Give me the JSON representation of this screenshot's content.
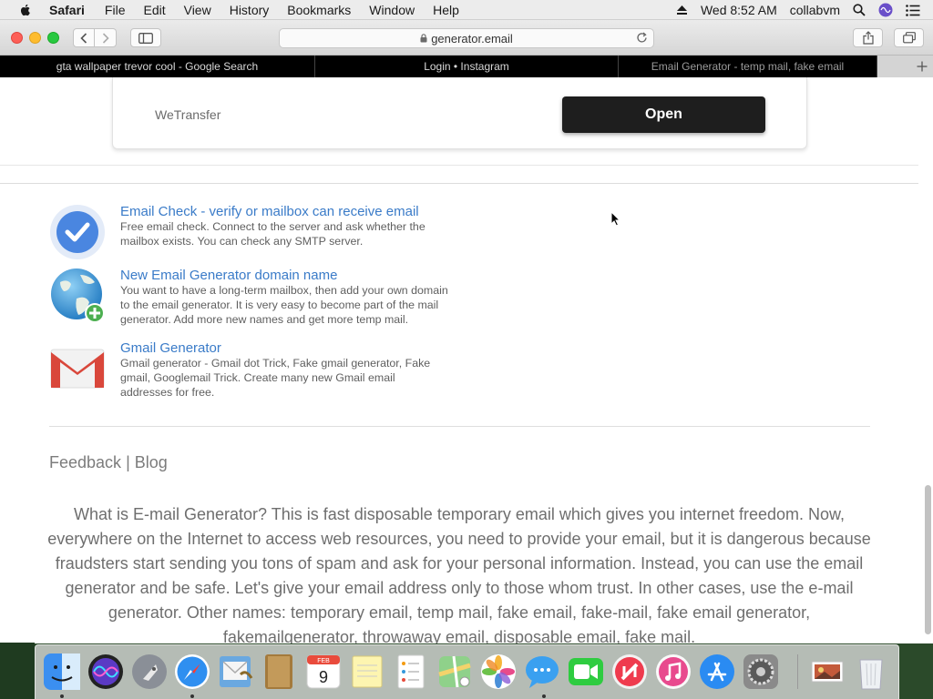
{
  "menubar": {
    "app_name": "Safari",
    "items": [
      "File",
      "Edit",
      "View",
      "History",
      "Bookmarks",
      "Window",
      "Help"
    ],
    "clock": "Wed 8:52 AM",
    "user": "collabvm"
  },
  "toolbar": {
    "url": "generator.email"
  },
  "tabs": [
    {
      "label": "gta wallpaper trevor cool - Google Search"
    },
    {
      "label": "Login • Instagram"
    },
    {
      "label": "Email Generator - temp mail, fake email"
    }
  ],
  "card": {
    "service": "WeTransfer",
    "button": "Open"
  },
  "features": [
    {
      "title": "Email Check - verify or mailbox can receive email",
      "description": "Free email check. Connect to the server and ask whether the mailbox exists. You can check any SMTP server.",
      "icon": "check-icon"
    },
    {
      "title": "New Email Generator domain name",
      "description": "You want to have a long-term mailbox, then add your own domain to the email generator. It is very easy to become part of the mail generator. Add more new names and get more temp mail.",
      "icon": "globe-add-icon"
    },
    {
      "title": "Gmail Generator",
      "description": "Gmail generator - Gmail dot Trick, Fake gmail generator, Fake gmail, Googlemail Trick. Create many new Gmail email addresses for free.",
      "icon": "gmail-icon"
    }
  ],
  "footer": {
    "feedback": "Feedback",
    "separator": " | ",
    "blog": "Blog"
  },
  "about": "What is E-mail Generator? This is fast disposable temporary email which gives you internet freedom. Now, everywhere on the Internet to access web resources, you need to provide your email, but it is dangerous because fraudsters start sending you tons of spam and ask for your personal information. Instead, you can use the email generator and be safe. Let's give your email address only to those whom trust. In other cases, use the e-mail generator. Other names: temporary email, temp mail, fake email, fake-mail, fake email generator, fakemailgenerator, throwaway email, disposable email, fake mail.",
  "dock": {
    "calendar_month": "FEB",
    "calendar_day": "9",
    "apps": [
      "Finder",
      "Siri",
      "Launchpad",
      "Safari",
      "Mail",
      "Notes",
      "Calendar",
      "Stickies",
      "Reminders",
      "Maps",
      "Photos",
      "Messages",
      "FaceTime",
      "News",
      "iTunes",
      "App Store",
      "System Preferences",
      "Photo Stack",
      "Trash"
    ]
  },
  "colors": {
    "link": "#3a7bc8",
    "button_dark": "#1e1e1e",
    "tabstrip": "#000000"
  }
}
